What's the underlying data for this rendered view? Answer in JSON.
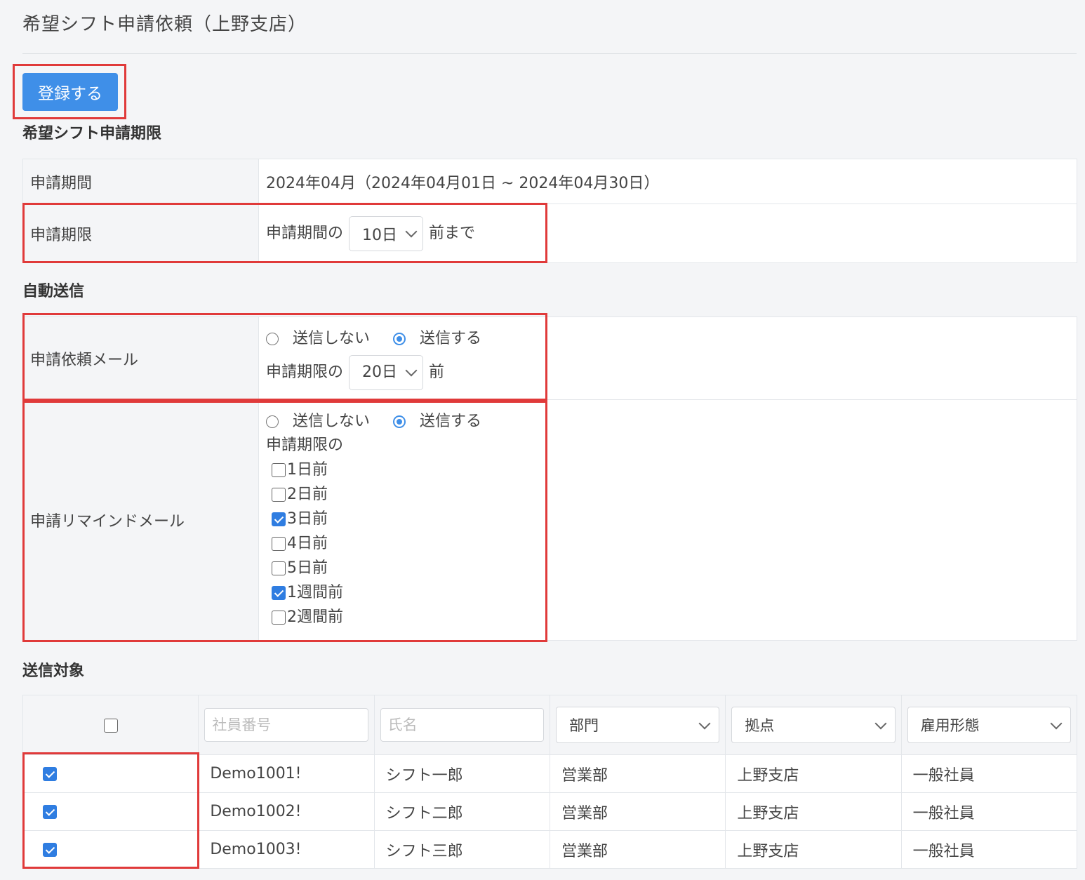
{
  "page": {
    "title": "希望シフト申請依頼（上野支店）"
  },
  "toolbar": {
    "register_label": "登録する"
  },
  "sections": {
    "deadline": "希望シフト申請期限",
    "auto_send": "自動送信",
    "targets": "送信対象"
  },
  "deadline_table": {
    "period_label": "申請期間",
    "period_value": "2024年04月（2024年04月01日 ~ 2024年04月30日）",
    "deadline_label": "申請期限",
    "deadline_prefix": "申請期間の",
    "deadline_select": "10日",
    "deadline_suffix": "前まで"
  },
  "auto_send_table": {
    "request_mail_label": "申請依頼メール",
    "no_send": "送信しない",
    "send": "送信する",
    "request_prefix": "申請期限の",
    "request_select": "20日",
    "request_suffix": "前",
    "remind_mail_label": "申請リマインドメール",
    "remind_prefix": "申請期限の",
    "remind_options": [
      {
        "label": "1日前",
        "checked": false
      },
      {
        "label": "2日前",
        "checked": false
      },
      {
        "label": "3日前",
        "checked": true
      },
      {
        "label": "4日前",
        "checked": false
      },
      {
        "label": "5日前",
        "checked": false
      },
      {
        "label": "1週間前",
        "checked": true
      },
      {
        "label": "2週間前",
        "checked": false
      }
    ]
  },
  "targets": {
    "filters": {
      "employee_no_placeholder": "社員番号",
      "name_placeholder": "氏名",
      "department": "部門",
      "location": "拠点",
      "employment_type": "雇用形態"
    },
    "rows": [
      {
        "checked": true,
        "employee_no": "Demo1001!",
        "name": "シフト一郎",
        "department": "営業部",
        "location": "上野支店",
        "employment_type": "一般社員"
      },
      {
        "checked": true,
        "employee_no": "Demo1002!",
        "name": "シフト二郎",
        "department": "営業部",
        "location": "上野支店",
        "employment_type": "一般社員"
      },
      {
        "checked": true,
        "employee_no": "Demo1003!",
        "name": "シフト三郎",
        "department": "営業部",
        "location": "上野支店",
        "employment_type": "一般社員"
      }
    ]
  },
  "colors": {
    "accent": "#3f8fe8",
    "highlight": "#e03a3a"
  }
}
